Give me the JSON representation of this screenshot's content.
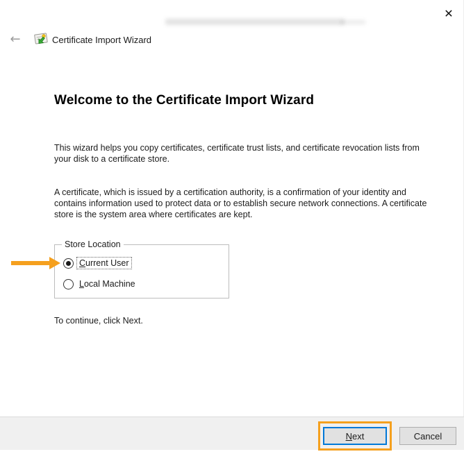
{
  "window": {
    "close_icon": "✕"
  },
  "header": {
    "back_icon": "←",
    "title": "Certificate Import Wizard"
  },
  "main": {
    "heading": "Welcome to the Certificate Import Wizard",
    "intro": "This wizard helps you copy certificates, certificate trust lists, and certificate revocation lists from your disk to a certificate store.",
    "description": "A certificate, which is issued by a certification authority, is a confirmation of your identity and contains information used to protect data or to establish secure network connections. A certificate store is the system area where certificates are kept.",
    "store_location": {
      "label": "Store Location",
      "options": [
        {
          "mnemonic": "C",
          "rest": "urrent User",
          "selected": true
        },
        {
          "mnemonic": "L",
          "rest": "ocal Machine",
          "selected": false
        }
      ]
    },
    "hint": "To continue, click Next."
  },
  "footer": {
    "next": {
      "mnemonic": "N",
      "rest": "ext"
    },
    "cancel": "Cancel"
  },
  "colors": {
    "annotation_orange": "#f5a01e",
    "default_button_blue": "#0078d7",
    "footer_background": "#f0f0f0"
  }
}
